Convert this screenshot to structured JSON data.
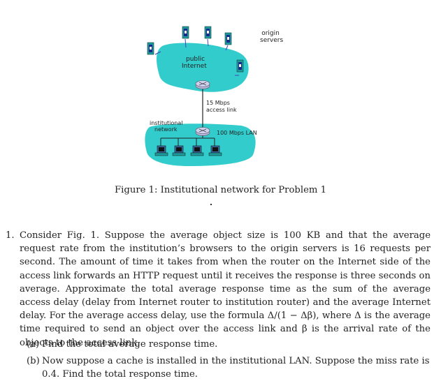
{
  "figure": {
    "labels": {
      "origin_servers": "origin\nservers",
      "origin_line1": "origin",
      "origin_line2": "servers",
      "public_line1": "public",
      "public_line2": "Internet",
      "access_line1": "15 Mbps",
      "access_line2": "access link",
      "inst_line1": "institutional",
      "inst_line2": "network",
      "lan": "100 Mbps LAN"
    },
    "colors": {
      "cloud": "#33cccc",
      "server_body": "#1e9a9a",
      "server_front": "#1a2a8a",
      "router": "#b8b8e0",
      "link": "#333333"
    },
    "server_count": 5,
    "host_count": 4
  },
  "caption": "Figure 1: Institutional network for Problem 1",
  "problem": {
    "number": "1.",
    "text": "Consider Fig. 1. Suppose the average object size is 100 KB and that the average request rate from the institution’s browsers to the origin servers is 16 requests per second. The amount of time it takes from when the router on the Internet side of the access link forwards an HTTP request until it receives the response is three seconds on average. Approximate the total average response time as the sum of the average access delay (delay from Internet router to institution router) and the average Internet delay. For the average access delay, use the formula Δ/(1 − Δβ), where Δ is the average time required to send an object over the access link and β is the arrival rate of the objects to the access link.",
    "parts": [
      {
        "tag": "(a)",
        "text": "Find the total average response time."
      },
      {
        "tag": "(b)",
        "text": "Now suppose a cache is installed in the institutional LAN. Suppose the miss rate is 0.4. Find the total response time."
      }
    ]
  }
}
